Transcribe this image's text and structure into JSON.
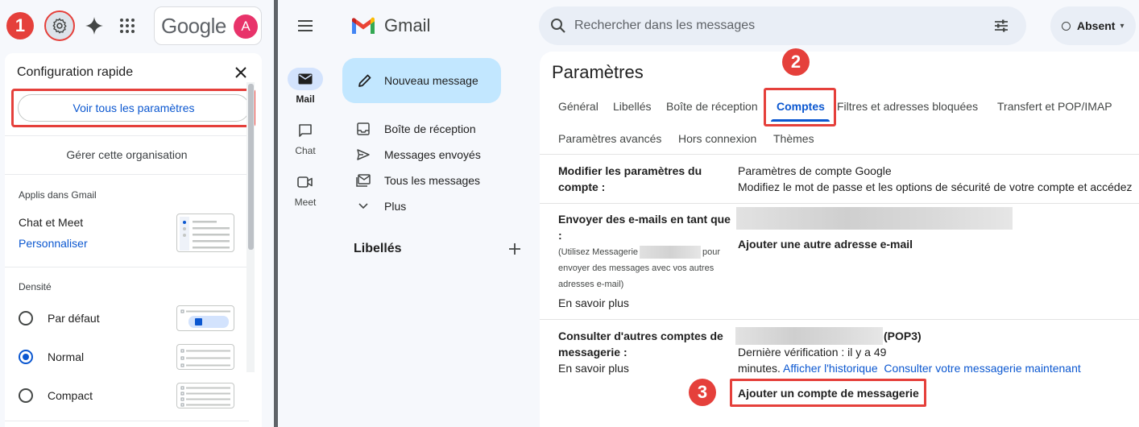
{
  "step_badges": [
    "1",
    "2",
    "3"
  ],
  "topbar_left": {
    "google_word": "Google",
    "avatar_letter": "A"
  },
  "quick_config": {
    "title": "Configuration rapide",
    "see_all_button": "Voir tous les paramètres",
    "manage_org": "Gérer cette organisation",
    "apps_section_title": "Applis dans Gmail",
    "chat_meet_label": "Chat et Meet",
    "personalize_link": "Personnaliser",
    "density_section_title": "Densité",
    "density_options": [
      {
        "label": "Par défaut",
        "selected": false
      },
      {
        "label": "Normal",
        "selected": true
      },
      {
        "label": "Compact",
        "selected": false
      }
    ]
  },
  "gmail": {
    "app_name": "Gmail",
    "search": {
      "placeholder": "Rechercher dans les messages"
    },
    "status": "Absent",
    "rail": [
      {
        "label": "Mail",
        "icon": "mail-icon",
        "active": true
      },
      {
        "label": "Chat",
        "icon": "chat-icon",
        "active": false
      },
      {
        "label": "Meet",
        "icon": "meet-icon",
        "active": false
      }
    ],
    "compose_label": "Nouveau message",
    "nav": [
      {
        "label": "Boîte de réception",
        "icon": "inbox-icon"
      },
      {
        "label": "Messages envoyés",
        "icon": "send-icon"
      },
      {
        "label": "Tous les messages",
        "icon": "all-mail-icon"
      },
      {
        "label": "Plus",
        "icon": "chevron-down-icon"
      }
    ],
    "labels_title": "Libellés"
  },
  "settings": {
    "title": "Paramètres",
    "tabs_row1": [
      "Général",
      "Libellés",
      "Boîte de réception",
      "Comptes",
      "Filtres et adresses bloquées",
      "Transfert et POP/IMAP"
    ],
    "tabs_row2": [
      "Paramètres avancés",
      "Hors connexion",
      "Thèmes"
    ],
    "active_tab": "Comptes",
    "rows": {
      "account": {
        "label_line1": "Modifier les paramètres du",
        "label_line2": "compte :",
        "link": "Paramètres de compte Google",
        "desc": "Modifiez le mot de passe et les options de sécurité de votre compte et accédez"
      },
      "send_as": {
        "label_line1": "Envoyer des e-mails en tant que",
        "label_line2": ":",
        "note_line1_a": "(Utilisez Messagerie",
        "note_line1_b": "pour",
        "note_line2": "envoyer des messages avec vos autres",
        "note_line3": "adresses e-mail)",
        "learn_more": "En savoir plus",
        "add_address": "Ajouter une autre adresse e-mail"
      },
      "check_mail": {
        "label_line1": "Consulter d'autres comptes de",
        "label_line2": "messagerie :",
        "learn_more": "En savoir plus",
        "pop_label": "(POP3)",
        "last_check_line1": "Dernière vérification : il y a 49",
        "last_check_line2": "minutes.",
        "history_link": "Afficher l'historique",
        "check_now_link": "Consulter votre messagerie maintenant",
        "add_account": "Ajouter un compte de messagerie"
      }
    }
  }
}
